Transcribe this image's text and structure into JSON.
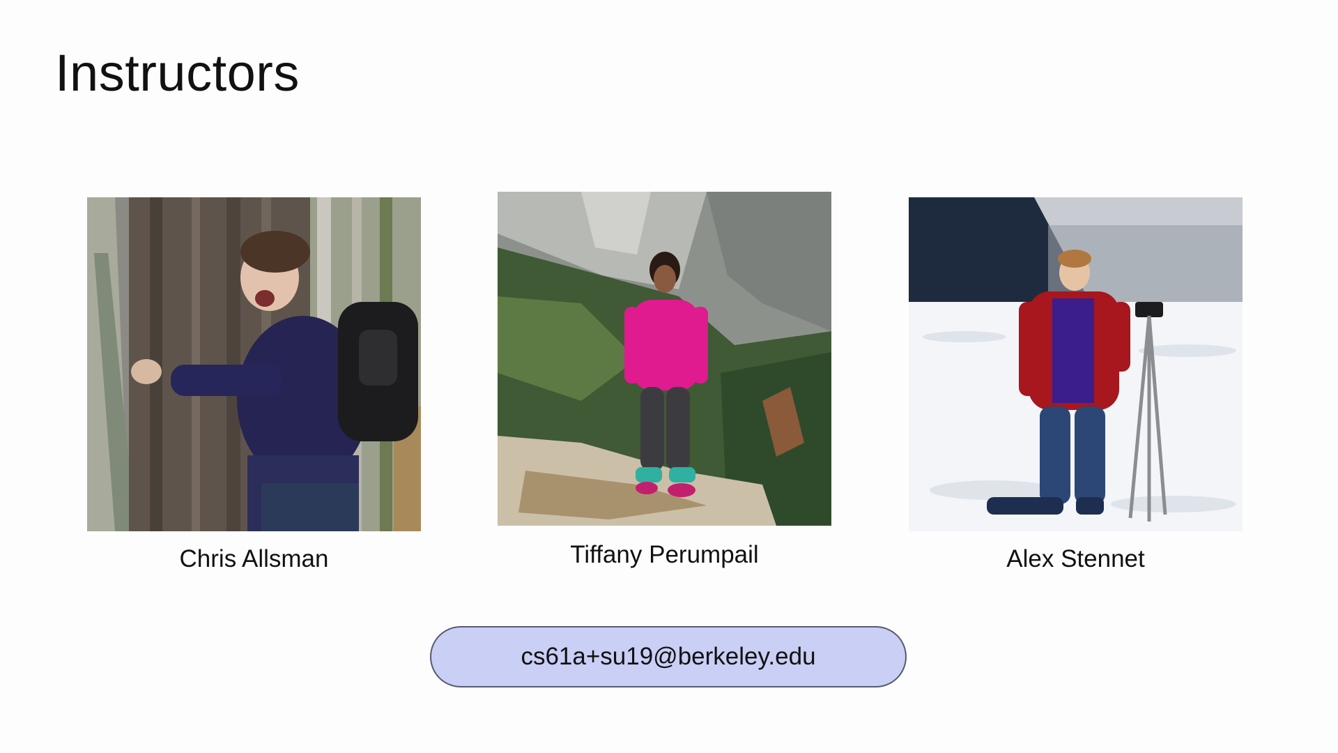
{
  "slide": {
    "title": "Instructors"
  },
  "instructors": [
    {
      "name": "Chris Allsman",
      "photo": "person-hugging-tree-photo"
    },
    {
      "name": "Tiffany Perumpail",
      "photo": "person-on-mountain-rock-photo"
    },
    {
      "name": "Alex Stennet",
      "photo": "person-in-snow-with-tripod-photo"
    }
  ],
  "contact": {
    "email": "cs61a+su19@berkeley.edu"
  },
  "colors": {
    "background": "#fdfdfd",
    "pill_fill": "#c9cff5",
    "pill_border": "#555a6e",
    "text": "#111111"
  }
}
